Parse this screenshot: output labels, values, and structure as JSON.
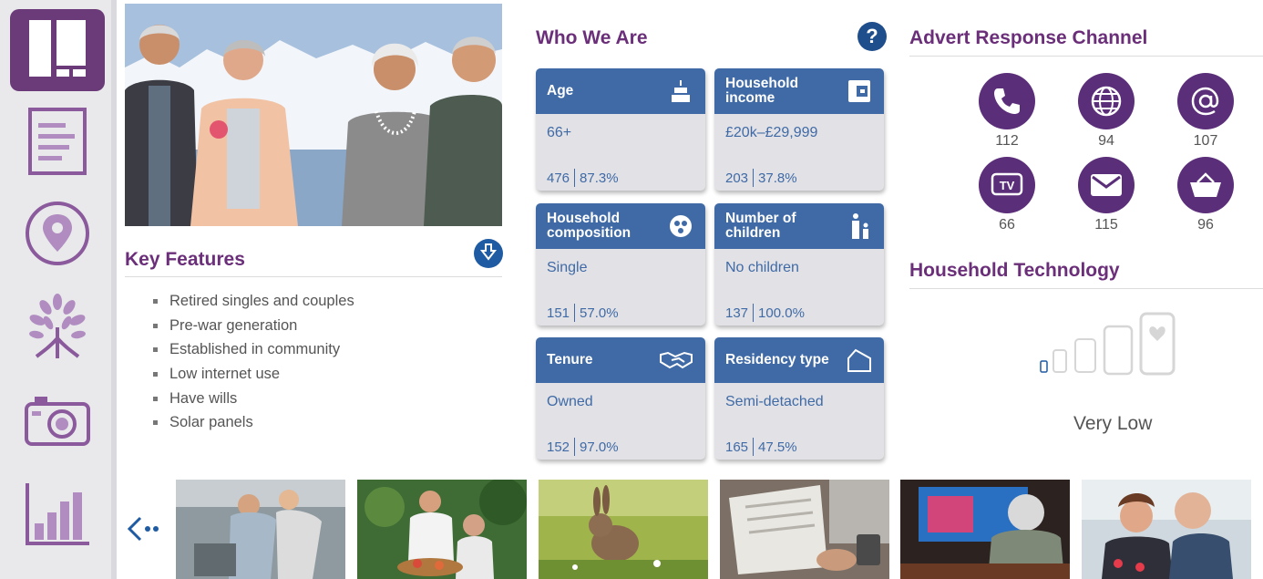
{
  "sidebar": {
    "items": [
      {
        "icon": "layout-icon",
        "active": true
      },
      {
        "icon": "document-icon",
        "active": false
      },
      {
        "icon": "location-pin-icon",
        "active": false
      },
      {
        "icon": "tree-icon",
        "active": false
      },
      {
        "icon": "camera-icon",
        "active": false
      },
      {
        "icon": "bar-chart-icon",
        "active": false
      }
    ]
  },
  "key_features": {
    "title": "Key Features",
    "items": [
      "Retired singles and couples",
      "Pre-war generation",
      "Established in community",
      "Low internet use",
      "Have wills",
      "Solar panels"
    ]
  },
  "who_we_are": {
    "title": "Who We Are",
    "help_icon": "help-icon",
    "cards": [
      {
        "title": "Age",
        "icon": "birthday-cake-icon",
        "value": "66+",
        "count": "476",
        "percent": "87.3%"
      },
      {
        "title": "Household income",
        "icon": "wallet-icon",
        "value": "£20k–£29,999",
        "count": "203",
        "percent": "37.8%"
      },
      {
        "title": "Household composition",
        "icon": "household-composition-icon",
        "value": "Single",
        "count": "151",
        "percent": "57.0%"
      },
      {
        "title": "Number of children",
        "icon": "adult-child-icon",
        "value": "No children",
        "count": "137",
        "percent": "100.0%"
      },
      {
        "title": "Tenure",
        "icon": "handshake-icon",
        "value": "Owned",
        "count": "152",
        "percent": "97.0%"
      },
      {
        "title": "Residency type",
        "icon": "house-icon",
        "value": "Semi-detached",
        "count": "165",
        "percent": "47.5%"
      }
    ]
  },
  "advert_response": {
    "title": "Advert Response Channel",
    "channels": [
      {
        "icon": "phone-icon",
        "value": "112"
      },
      {
        "icon": "globe-icon",
        "value": "94"
      },
      {
        "icon": "at-sign-icon",
        "value": "107"
      },
      {
        "icon": "tv-icon",
        "value": "66"
      },
      {
        "icon": "envelope-icon",
        "value": "115"
      },
      {
        "icon": "shopping-basket-icon",
        "value": "96"
      }
    ]
  },
  "household_technology": {
    "title": "Household Technology",
    "level_label": "Very Low"
  },
  "gallery": {
    "back_icon": "back-arrow-icon",
    "thumbnails": [
      "photo-shopping",
      "photo-gardening",
      "photo-rabbit",
      "photo-newspaper",
      "photo-watching-tv",
      "photo-couple-cruise"
    ]
  },
  "colors": {
    "brand_purple": "#6b2f7a",
    "card_blue": "#3f6aa6",
    "sidebar_bg": "#e9e9ec"
  }
}
